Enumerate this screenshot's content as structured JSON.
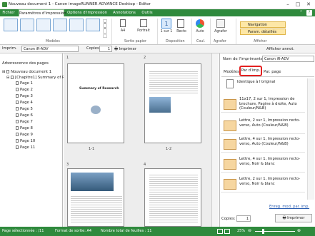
{
  "window": {
    "title": "Nouveau document 1 - Canon imageRUNNER ADVANCE Desktop - Editor"
  },
  "tabs": [
    "Fichier",
    "Paramètres d'impression",
    "Options d'impression",
    "Annotations",
    "Outils"
  ],
  "ribbon": {
    "groups": [
      "Modèles",
      "Sortie papier",
      "Disposition",
      "Coul.",
      "Agrafer",
      "Afficher"
    ],
    "paper_size": "A4",
    "orientation": "Portrait",
    "layout": "1 sur 1",
    "duplex": "Recto",
    "color": "Auto",
    "staple": "Agrafer",
    "navigation": "Navigation",
    "details": "Param. détaillés"
  },
  "printerbar": {
    "printer_label": "Imprim.",
    "printer_value": "Canon iR-ADV",
    "copies_label": "Copies",
    "copies_value": "1",
    "print_button": "Imprimer",
    "show_annot": "Afficher annot."
  },
  "tree": {
    "title": "Arborescence des pages",
    "root": "Nouveau document 1",
    "chapter": "[Chapitre1] Summary of R",
    "pages": [
      "Page 1",
      "Page 2",
      "Page 3",
      "Page 4",
      "Page 5",
      "Page 6",
      "Page 7",
      "Page 8",
      "Page 9",
      "Page 10",
      "Page 11"
    ]
  },
  "preview": {
    "page_numbers": [
      "1",
      "2",
      "3",
      "4"
    ],
    "captions": [
      "1-1",
      "1-2"
    ],
    "doc_heading": "Summary of Research"
  },
  "right_panel": {
    "printer_name_label": "Nom de l'imprimante :",
    "printer_name_value": "Canon iR-ADV",
    "tabs": [
      "Modèles",
      "Par d'imp.",
      "Par. page"
    ],
    "top_item": "Identique à l'original",
    "items": [
      "11x17, 2 sur 1, Impression de brochure, Pagine à droite, Auto (Couleur/N&B)",
      "Lettre, 2 sur 1, Impression recto-verso, Auto (Couleur/N&B)",
      "Lettre, 4 sur 1, Impression recto-verso, Auto (Couleur/N&B)",
      "Lettre, 4 sur 1, Impression recto-verso, Noir & blanc",
      "Lettre, 2 sur 1, Impression recto-verso, Noir & blanc"
    ],
    "save_link": "Enreg. mod. par. imp.",
    "copies_label": "Copies:",
    "copies_value": "1",
    "print_button": "Imprimer"
  },
  "status": {
    "selected": "Page sélectionnée : /11",
    "format": "Format de sortie: A4",
    "sheets": "Nombre total de feuilles : 11",
    "zoom": "25%"
  }
}
